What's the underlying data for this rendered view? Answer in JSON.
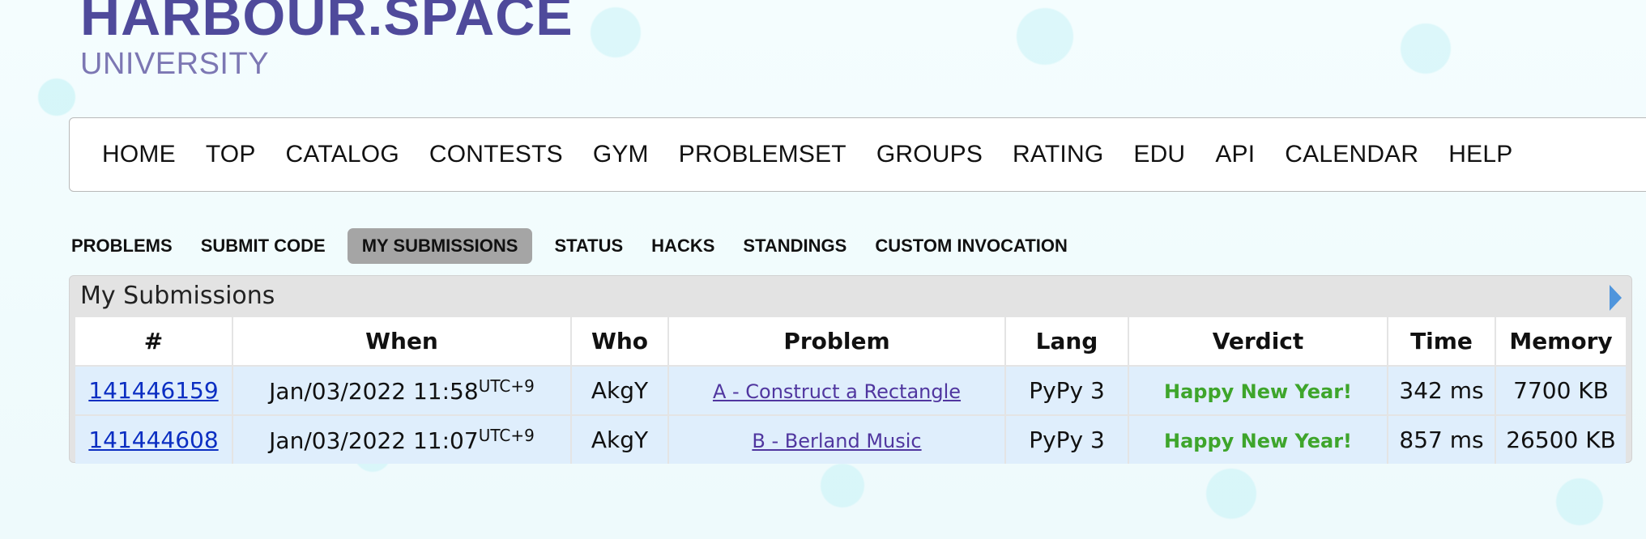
{
  "logo": {
    "main": "HARBOUR.SPACE",
    "sub": "UNIVERSITY"
  },
  "main_menu": [
    "HOME",
    "TOP",
    "CATALOG",
    "CONTESTS",
    "GYM",
    "PROBLEMSET",
    "GROUPS",
    "RATING",
    "EDU",
    "API",
    "CALENDAR",
    "HELP"
  ],
  "second_menu": [
    {
      "label": "PROBLEMS",
      "active": false
    },
    {
      "label": "SUBMIT CODE",
      "active": false
    },
    {
      "label": "MY SUBMISSIONS",
      "active": true
    },
    {
      "label": "STATUS",
      "active": false
    },
    {
      "label": "HACKS",
      "active": false
    },
    {
      "label": "STANDINGS",
      "active": false
    },
    {
      "label": "CUSTOM INVOCATION",
      "active": false
    }
  ],
  "submissions": {
    "title": "My Submissions",
    "columns": [
      "#",
      "When",
      "Who",
      "Problem",
      "Lang",
      "Verdict",
      "Time",
      "Memory"
    ],
    "rows": [
      {
        "id": "141446159",
        "when": "Jan/03/2022 11:58",
        "tz": "UTC+9",
        "who": "AkgY",
        "problem": "A - Construct a Rectangle",
        "lang": "PyPy 3",
        "verdict": "Happy New Year!",
        "time": "342 ms",
        "memory": "7700 KB"
      },
      {
        "id": "141444608",
        "when": "Jan/03/2022 11:07",
        "tz": "UTC+9",
        "who": "AkgY",
        "problem": "B - Berland Music",
        "lang": "PyPy 3",
        "verdict": "Happy New Year!",
        "time": "857 ms",
        "memory": "26500 KB"
      }
    ]
  },
  "colors": {
    "logo": "#4f4a9b",
    "link": "#0b2ec2",
    "problem_link": "#50369f",
    "verdict_ok": "#3ea52b",
    "row_bg": "#dfeefc",
    "active_tab": "#a5a5a5"
  }
}
